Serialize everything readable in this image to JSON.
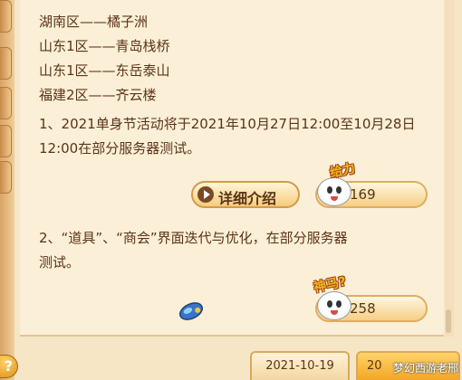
{
  "server_list": [
    "湖南区——橘子洲",
    "山东1区——青岛栈桥",
    "山东1区——东岳泰山",
    "福建2区——齐云楼"
  ],
  "notices": [
    {
      "lines": [
        "1、2021单身节活动将于2021年10月27日12:00至10月28日",
        "12:00在部分服务器测试。"
      ],
      "has_detail_button": true,
      "detail_label": "详细介绍",
      "reaction_caption": "给力",
      "reaction_count": "169"
    },
    {
      "lines": [
        "2、“道具”、“商会”界面迭代与优化，在部分服务器",
        "测试。"
      ],
      "has_detail_button": false,
      "reaction_caption": "神马?",
      "reaction_count": "258"
    }
  ],
  "date_tabs": [
    {
      "label": "2021-10-19",
      "active": false
    },
    {
      "label": "20",
      "active": true
    }
  ],
  "help_icon": "?",
  "watermark": "梦幻西游老邢",
  "colors": {
    "text": "#5a3418",
    "panel_bg": "#fbefd7",
    "accent_orange": "#f3a724"
  }
}
